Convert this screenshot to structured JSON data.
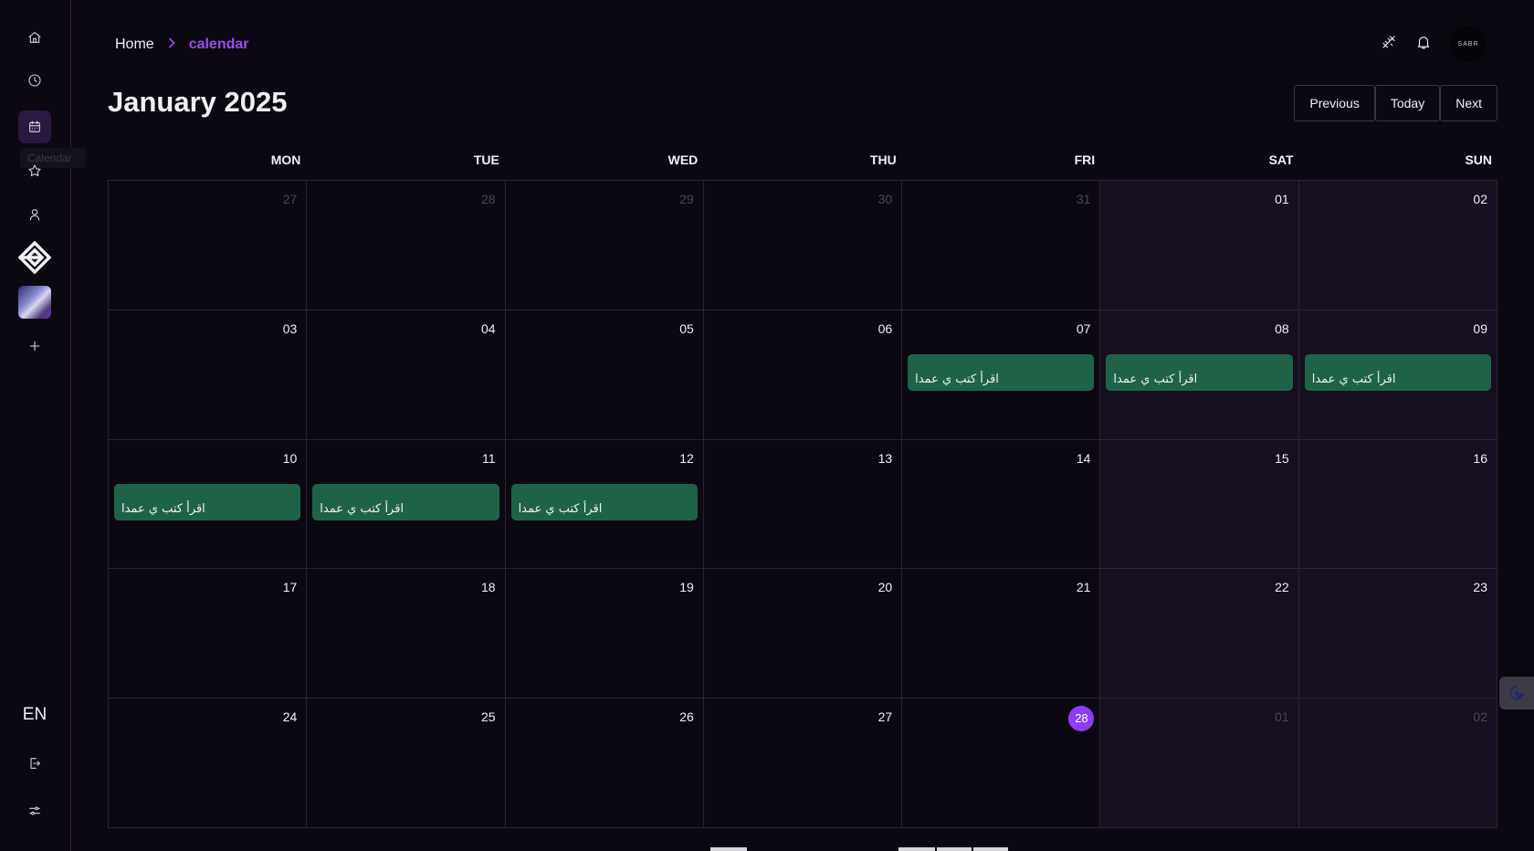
{
  "sidebar": {
    "items": [
      {
        "name": "home-icon"
      },
      {
        "name": "clock-icon"
      },
      {
        "name": "calendar-icon",
        "active": true
      },
      {
        "name": "star-icon"
      },
      {
        "name": "user-icon"
      }
    ],
    "tooltip": "Calendar",
    "language": "EN"
  },
  "breadcrumb": {
    "home": "Home",
    "separator": ">",
    "current": "calendar"
  },
  "header": {
    "avatar_text": "SABR"
  },
  "calendar": {
    "month": "January",
    "year": "2025",
    "buttons": {
      "previous": "Previous",
      "today": "Today",
      "next": "Next"
    },
    "weekdays": [
      "MON",
      "TUE",
      "WED",
      "THU",
      "FRI",
      "SAT",
      "SUN"
    ],
    "weeks": [
      [
        {
          "day": "27",
          "other": true
        },
        {
          "day": "28",
          "other": true
        },
        {
          "day": "29",
          "other": true
        },
        {
          "day": "30",
          "other": true
        },
        {
          "day": "31",
          "other": true
        },
        {
          "day": "01"
        },
        {
          "day": "02"
        }
      ],
      [
        {
          "day": "03"
        },
        {
          "day": "04"
        },
        {
          "day": "05"
        },
        {
          "day": "06"
        },
        {
          "day": "07",
          "event": "اقرأ كتب ي عمدا"
        },
        {
          "day": "08",
          "event": "اقرأ كتب ي عمدا"
        },
        {
          "day": "09",
          "event": "اقرأ كتب ي عمدا"
        }
      ],
      [
        {
          "day": "10",
          "event": "اقرأ كتب ي عمدا"
        },
        {
          "day": "11",
          "event": "اقرأ كتب ي عمدا"
        },
        {
          "day": "12",
          "event": "اقرأ كتب ي عمدا"
        },
        {
          "day": "13"
        },
        {
          "day": "14"
        },
        {
          "day": "15"
        },
        {
          "day": "16"
        }
      ],
      [
        {
          "day": "17"
        },
        {
          "day": "18"
        },
        {
          "day": "19"
        },
        {
          "day": "20"
        },
        {
          "day": "21"
        },
        {
          "day": "22"
        },
        {
          "day": "23"
        }
      ],
      [
        {
          "day": "24"
        },
        {
          "day": "25"
        },
        {
          "day": "26"
        },
        {
          "day": "27"
        },
        {
          "day": "28",
          "today": true
        },
        {
          "day": "01",
          "other": true
        },
        {
          "day": "02",
          "other": true
        }
      ]
    ]
  },
  "colors": {
    "background": "#0c0812",
    "accent": "#8f3df0",
    "event": "#1e6348",
    "weekend_cell": "#150f1f",
    "border": "#2a2533"
  }
}
